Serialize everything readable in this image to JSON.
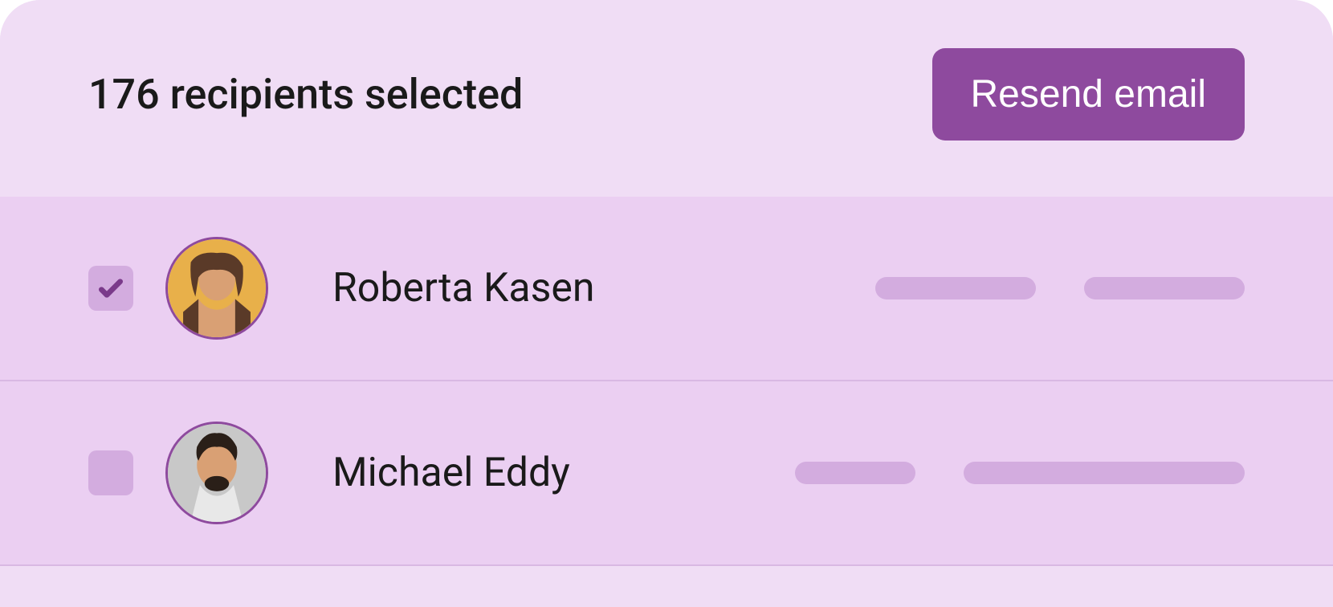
{
  "header": {
    "title": "176 recipients selected",
    "resend_label": "Resend email"
  },
  "recipients": [
    {
      "name": "Roberta Kasen",
      "checked": true,
      "placeholders": [
        200,
        200
      ]
    },
    {
      "name": "Michael Eddy",
      "checked": false,
      "placeholders": [
        150,
        350
      ]
    }
  ]
}
